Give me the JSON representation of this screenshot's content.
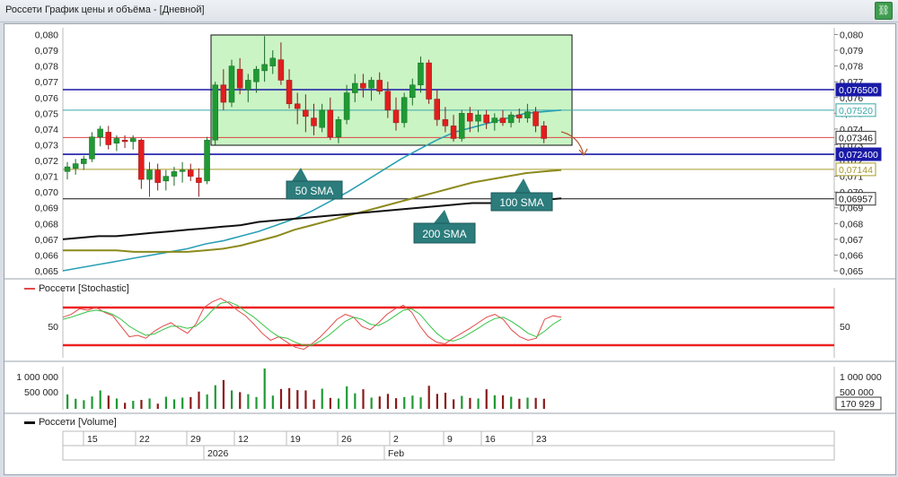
{
  "window": {
    "title": "Россети График цены и объёма - [Дневной]",
    "link_icon": "link-icon"
  },
  "price_panel": {
    "y_ticks": [
      "0,080",
      "0,079",
      "0,078",
      "0,077",
      "0,076",
      "0,075",
      "0,074",
      "0,073",
      "0,072",
      "0,071",
      "0,070",
      "0,069",
      "0,068",
      "0,067",
      "0,066",
      "0,065"
    ],
    "levels": [
      {
        "label": "0,076500",
        "value": 0.0765,
        "color": "#1a1aa8",
        "style": "filled"
      },
      {
        "label": "0,07520",
        "value": 0.0752,
        "color": "#3aa6a6",
        "style": "outline"
      },
      {
        "label": "0,07346",
        "value": 0.07346,
        "color": "#d44",
        "style": "plain"
      },
      {
        "label": "0,072400",
        "value": 0.0724,
        "color": "#1a1aa8",
        "style": "filled"
      },
      {
        "label": "0,07144",
        "value": 0.07144,
        "color": "#a89a2a",
        "style": "outline"
      },
      {
        "label": "0,06957",
        "value": 0.06957,
        "color": "#111111",
        "style": "plain"
      }
    ],
    "annotations": [
      "50 SMA",
      "100 SMA",
      "200 SMA"
    ]
  },
  "stochastic_panel": {
    "legend": "Россети [Stochastic]",
    "left_tick": "50",
    "right_tick": "50"
  },
  "volume_panel": {
    "legend": "Россети [Volume]",
    "left_ticks": [
      "1 000 000",
      "500 000"
    ],
    "right_ticks": [
      "1 000 000",
      "500 000"
    ],
    "last_value": "170 929"
  },
  "time_axis": {
    "days": [
      "15",
      "22",
      "29",
      "12",
      "19",
      "26",
      "2",
      "9",
      "16",
      "23"
    ],
    "periods": [
      "2026",
      "Feb"
    ]
  },
  "chart_data": {
    "type": "candlestick",
    "ylim": [
      0.065,
      0.0802
    ],
    "candles": [
      {
        "o": 0.0713,
        "h": 0.0719,
        "l": 0.0708,
        "c": 0.0716
      },
      {
        "o": 0.0715,
        "h": 0.0721,
        "l": 0.0711,
        "c": 0.0718
      },
      {
        "o": 0.0718,
        "h": 0.0723,
        "l": 0.0714,
        "c": 0.0721
      },
      {
        "o": 0.0721,
        "h": 0.0738,
        "l": 0.0719,
        "c": 0.0735
      },
      {
        "o": 0.0735,
        "h": 0.0742,
        "l": 0.0729,
        "c": 0.074
      },
      {
        "o": 0.0738,
        "h": 0.0742,
        "l": 0.0727,
        "c": 0.073
      },
      {
        "o": 0.0731,
        "h": 0.0736,
        "l": 0.0726,
        "c": 0.0734
      },
      {
        "o": 0.0733,
        "h": 0.0736,
        "l": 0.0728,
        "c": 0.0732
      },
      {
        "o": 0.0732,
        "h": 0.0736,
        "l": 0.0727,
        "c": 0.0734
      },
      {
        "o": 0.0733,
        "h": 0.0734,
        "l": 0.0702,
        "c": 0.0708
      },
      {
        "o": 0.0708,
        "h": 0.0719,
        "l": 0.0697,
        "c": 0.0714
      },
      {
        "o": 0.0714,
        "h": 0.0718,
        "l": 0.0701,
        "c": 0.0706
      },
      {
        "o": 0.0707,
        "h": 0.0714,
        "l": 0.0701,
        "c": 0.071
      },
      {
        "o": 0.071,
        "h": 0.0716,
        "l": 0.0704,
        "c": 0.0713
      },
      {
        "o": 0.0713,
        "h": 0.0719,
        "l": 0.0706,
        "c": 0.0714
      },
      {
        "o": 0.0714,
        "h": 0.0718,
        "l": 0.0707,
        "c": 0.071
      },
      {
        "o": 0.0709,
        "h": 0.0715,
        "l": 0.0697,
        "c": 0.0706
      },
      {
        "o": 0.0707,
        "h": 0.0735,
        "l": 0.0705,
        "c": 0.0733
      },
      {
        "o": 0.0733,
        "h": 0.077,
        "l": 0.073,
        "c": 0.0768
      },
      {
        "o": 0.0768,
        "h": 0.0778,
        "l": 0.0752,
        "c": 0.0757
      },
      {
        "o": 0.0757,
        "h": 0.0784,
        "l": 0.0754,
        "c": 0.078
      },
      {
        "o": 0.0778,
        "h": 0.0785,
        "l": 0.0762,
        "c": 0.0766
      },
      {
        "o": 0.0765,
        "h": 0.0775,
        "l": 0.0757,
        "c": 0.0771
      },
      {
        "o": 0.077,
        "h": 0.078,
        "l": 0.0763,
        "c": 0.0778
      },
      {
        "o": 0.0777,
        "h": 0.0799,
        "l": 0.077,
        "c": 0.0781
      },
      {
        "o": 0.078,
        "h": 0.079,
        "l": 0.0775,
        "c": 0.0785
      },
      {
        "o": 0.0784,
        "h": 0.0795,
        "l": 0.0768,
        "c": 0.0771
      },
      {
        "o": 0.0771,
        "h": 0.0778,
        "l": 0.0753,
        "c": 0.0756
      },
      {
        "o": 0.0756,
        "h": 0.0763,
        "l": 0.0743,
        "c": 0.0753
      },
      {
        "o": 0.0752,
        "h": 0.0762,
        "l": 0.0738,
        "c": 0.0748
      },
      {
        "o": 0.0747,
        "h": 0.0756,
        "l": 0.0736,
        "c": 0.0742
      },
      {
        "o": 0.0741,
        "h": 0.0756,
        "l": 0.0738,
        "c": 0.0752
      },
      {
        "o": 0.0752,
        "h": 0.076,
        "l": 0.0733,
        "c": 0.0735
      },
      {
        "o": 0.0735,
        "h": 0.0748,
        "l": 0.0731,
        "c": 0.0746
      },
      {
        "o": 0.0746,
        "h": 0.0768,
        "l": 0.0743,
        "c": 0.0763
      },
      {
        "o": 0.0763,
        "h": 0.0775,
        "l": 0.0757,
        "c": 0.0769
      },
      {
        "o": 0.0769,
        "h": 0.0775,
        "l": 0.076,
        "c": 0.0766
      },
      {
        "o": 0.0766,
        "h": 0.0773,
        "l": 0.0758,
        "c": 0.0771
      },
      {
        "o": 0.0771,
        "h": 0.0776,
        "l": 0.0762,
        "c": 0.0764
      },
      {
        "o": 0.0764,
        "h": 0.077,
        "l": 0.0747,
        "c": 0.0752
      },
      {
        "o": 0.0752,
        "h": 0.076,
        "l": 0.0739,
        "c": 0.0744
      },
      {
        "o": 0.0744,
        "h": 0.0763,
        "l": 0.0741,
        "c": 0.076
      },
      {
        "o": 0.076,
        "h": 0.0772,
        "l": 0.0755,
        "c": 0.0768
      },
      {
        "o": 0.0768,
        "h": 0.0786,
        "l": 0.0763,
        "c": 0.0782
      },
      {
        "o": 0.0782,
        "h": 0.0784,
        "l": 0.0756,
        "c": 0.0759
      },
      {
        "o": 0.0759,
        "h": 0.0765,
        "l": 0.0742,
        "c": 0.0746
      },
      {
        "o": 0.0746,
        "h": 0.0754,
        "l": 0.0738,
        "c": 0.0742
      },
      {
        "o": 0.0742,
        "h": 0.0749,
        "l": 0.0732,
        "c": 0.0734
      },
      {
        "o": 0.0734,
        "h": 0.0752,
        "l": 0.0732,
        "c": 0.075
      },
      {
        "o": 0.075,
        "h": 0.0754,
        "l": 0.0738,
        "c": 0.0745
      },
      {
        "o": 0.0745,
        "h": 0.0752,
        "l": 0.0738,
        "c": 0.0749
      },
      {
        "o": 0.0749,
        "h": 0.0752,
        "l": 0.074,
        "c": 0.0744
      },
      {
        "o": 0.0744,
        "h": 0.075,
        "l": 0.0739,
        "c": 0.0747
      },
      {
        "o": 0.0747,
        "h": 0.0752,
        "l": 0.0742,
        "c": 0.0744
      },
      {
        "o": 0.0744,
        "h": 0.0751,
        "l": 0.0741,
        "c": 0.0749
      },
      {
        "o": 0.0749,
        "h": 0.0753,
        "l": 0.0744,
        "c": 0.0747
      },
      {
        "o": 0.0747,
        "h": 0.0756,
        "l": 0.0744,
        "c": 0.0751
      },
      {
        "o": 0.0751,
        "h": 0.0754,
        "l": 0.0738,
        "c": 0.0742
      },
      {
        "o": 0.0742,
        "h": 0.0745,
        "l": 0.0731,
        "c": 0.0734
      }
    ],
    "volume": [
      500000,
      350000,
      300000,
      430000,
      640000,
      460000,
      360000,
      210000,
      280000,
      310000,
      360000,
      180000,
      420000,
      330000,
      390000,
      410000,
      600000,
      500000,
      820000,
      1000000,
      640000,
      580000,
      510000,
      410000,
      1400000,
      460000,
      690000,
      720000,
      650000,
      640000,
      320000,
      700000,
      380000,
      360000,
      780000,
      540000,
      680000,
      390000,
      430000,
      520000,
      370000,
      410000,
      460000,
      400000,
      800000,
      520000,
      560000,
      330000,
      450000,
      380000,
      360000,
      680000,
      470000,
      470000,
      420000,
      350000,
      390000,
      380000,
      350000
    ],
    "stochastic": {
      "k": [
        58,
        62,
        70,
        68,
        72,
        65,
        60,
        45,
        30,
        32,
        28,
        38,
        45,
        50,
        42,
        35,
        48,
        72,
        80,
        85,
        78,
        68,
        60,
        48,
        35,
        25,
        30,
        22,
        15,
        12,
        20,
        30,
        42,
        55,
        62,
        58,
        45,
        40,
        50,
        62,
        70,
        75,
        65,
        45,
        30,
        22,
        20,
        28,
        35,
        42,
        50,
        58,
        62,
        55,
        40,
        30,
        25,
        28,
        55,
        60,
        58
      ],
      "d": [
        55,
        58,
        62,
        66,
        68,
        66,
        62,
        55,
        45,
        38,
        32,
        34,
        40,
        45,
        45,
        42,
        45,
        55,
        68,
        78,
        80,
        75,
        66,
        58,
        48,
        38,
        30,
        28,
        22,
        18,
        18,
        24,
        32,
        42,
        52,
        58,
        55,
        48,
        46,
        52,
        60,
        68,
        70,
        62,
        48,
        35,
        26,
        24,
        28,
        35,
        42,
        50,
        56,
        58,
        52,
        44,
        35,
        30,
        38,
        48,
        55
      ]
    },
    "sma": {
      "sma50": [
        0.065,
        0.0652,
        0.0654,
        0.0656,
        0.0658,
        0.066,
        0.0662,
        0.0664,
        0.0667,
        0.0669,
        0.0672,
        0.0675,
        0.0679,
        0.0683,
        0.0688,
        0.0694,
        0.07,
        0.0707,
        0.0714,
        0.0721,
        0.0727,
        0.0733,
        0.0738,
        0.0741,
        0.0744,
        0.0747,
        0.075,
        0.0751,
        0.0752
      ],
      "sma100": [
        0.0663,
        0.0663,
        0.0663,
        0.0663,
        0.0662,
        0.0662,
        0.0662,
        0.0662,
        0.0663,
        0.0664,
        0.0666,
        0.0669,
        0.0672,
        0.0676,
        0.0679,
        0.0682,
        0.0685,
        0.0688,
        0.0691,
        0.0694,
        0.0697,
        0.07,
        0.0703,
        0.0706,
        0.0708,
        0.071,
        0.0712,
        0.0713,
        0.0714
      ],
      "sma200": [
        0.067,
        0.0671,
        0.0672,
        0.0672,
        0.0673,
        0.0674,
        0.0675,
        0.0676,
        0.0677,
        0.0678,
        0.0679,
        0.0681,
        0.0682,
        0.0683,
        0.0684,
        0.0685,
        0.0686,
        0.0687,
        0.0688,
        0.0689,
        0.069,
        0.0691,
        0.0692,
        0.0693,
        0.0693,
        0.0694,
        0.0694,
        0.0695,
        0.0696
      ]
    }
  }
}
